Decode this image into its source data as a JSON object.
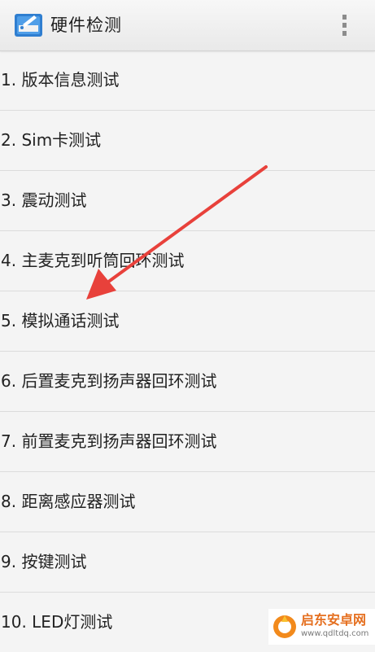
{
  "app_bar": {
    "title": "硬件检测",
    "icon": "hardware-test-icon",
    "menu_icon": "overflow-menu-icon"
  },
  "tests": [
    {
      "label": "1. 版本信息测试"
    },
    {
      "label": "2. Sim卡测试"
    },
    {
      "label": "3. 震动测试"
    },
    {
      "label": "4. 主麦克到听筒回环测试"
    },
    {
      "label": "5. 模拟通话测试"
    },
    {
      "label": "6. 后置麦克到扬声器回环测试"
    },
    {
      "label": "7. 前置麦克到扬声器回环测试"
    },
    {
      "label": "8. 距离感应器测试"
    },
    {
      "label": "9. 按键测试"
    },
    {
      "label": "10. LED灯测试"
    }
  ],
  "annotation": {
    "arrow_color": "#e8413b"
  },
  "watermark": {
    "title": "启东安卓网",
    "url": "www.qdltdq.com"
  }
}
